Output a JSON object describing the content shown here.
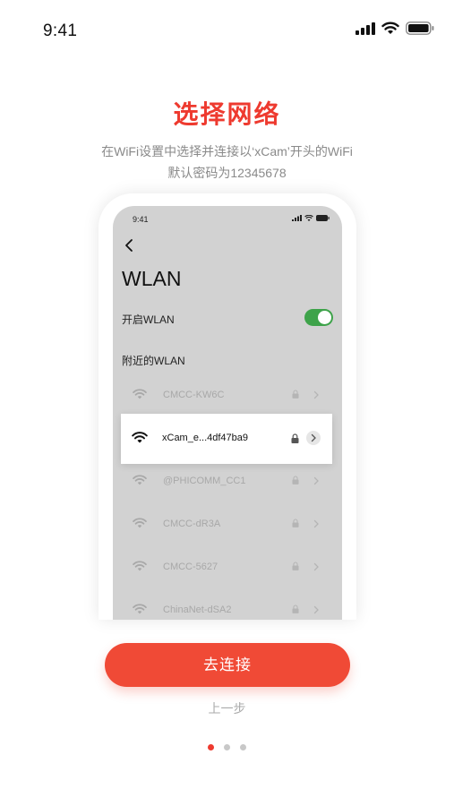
{
  "status_bar": {
    "time": "9:41"
  },
  "header": {
    "title": "选择网络",
    "subtitle_line1": "在WiFi设置中选择并连接以‘xCam’开头的WiFi",
    "subtitle_line2": "默认密码为12345678"
  },
  "mockup": {
    "time": "9:41",
    "screen_title": "WLAN",
    "open_wlan_label": "开启WLAN",
    "wlan_enabled": true,
    "nearby_label": "附近的WLAN",
    "networks": [
      {
        "name": "CMCC-KW6C",
        "locked": true
      },
      {
        "name": "@PHICOMM_CC1",
        "locked": true
      },
      {
        "name": "CMCC-dR3A",
        "locked": true
      },
      {
        "name": "CMCC-5627",
        "locked": true
      },
      {
        "name": "ChinaNet-dSA2",
        "locked": true
      }
    ],
    "highlighted_network": {
      "name": "xCam_e...4df47ba9",
      "locked": true
    }
  },
  "actions": {
    "connect_label": "去连接",
    "prev_label": "上一步"
  },
  "pagination": {
    "total": 3,
    "current": 1
  },
  "colors": {
    "accent": "#ee3a2f",
    "button": "#f04a36",
    "toggle_on": "#3ea34a"
  }
}
